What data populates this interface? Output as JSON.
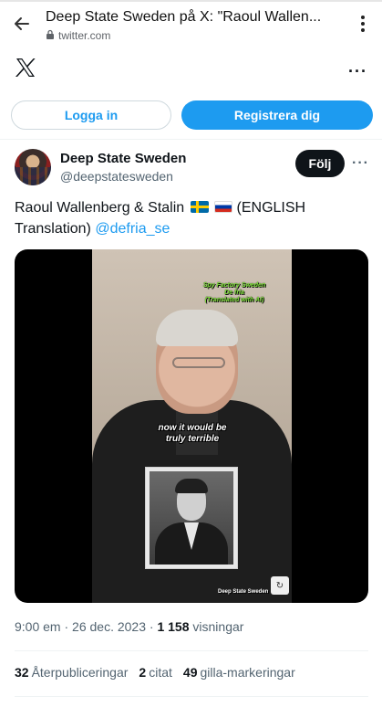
{
  "browser": {
    "page_title": "Deep State Sweden på X: \"Raoul Wallen...",
    "url": "twitter.com",
    "icons": {
      "back": "arrow-left-icon",
      "lock": "lock-icon",
      "menu": "more-vertical-icon"
    }
  },
  "header": {
    "logo": "x-logo-icon",
    "more_label": "···"
  },
  "auth": {
    "login_label": "Logga in",
    "register_label": "Registrera dig"
  },
  "author": {
    "name": "Deep State Sweden",
    "handle": "@deepstatesweden",
    "follow_label": "Följ",
    "more_label": "···"
  },
  "tweet": {
    "text_part1": "Raoul Wallenberg & Stalin",
    "text_part2": "(ENGLISH Translation)",
    "mention": "@defria_se",
    "flags": [
      "flag-sweden-icon",
      "flag-russia-icon"
    ]
  },
  "video": {
    "overlay_top_line1": "Spy Factory Sweden",
    "overlay_top_line2": "De fria",
    "overlay_top_line3": "(Translated with AI)",
    "caption_line1": "now it would be",
    "caption_line2": "truly terrible",
    "watermark": "Deep State Sweden"
  },
  "meta": {
    "time": "9:00 em",
    "date": "26 dec. 2023",
    "views_count": "1 158",
    "views_label": "visningar"
  },
  "stats": {
    "reposts_count": "32",
    "reposts_label": "Återpubliceringar",
    "quotes_count": "2",
    "quotes_label": "citat",
    "likes_count": "49",
    "likes_label": "gilla-markeringar"
  },
  "colors": {
    "accent": "#1d9bf0",
    "text": "#0f1419",
    "muted": "#536471",
    "dark_button": "#0f1419"
  }
}
